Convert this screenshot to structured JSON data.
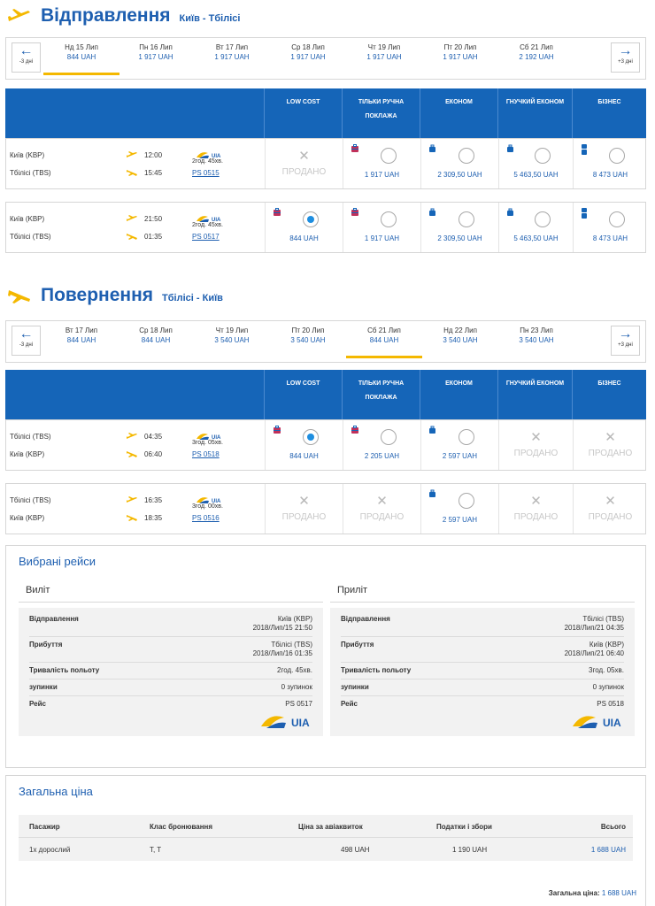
{
  "colors": {
    "brand_blue": "#1e5fb0",
    "header_blue": "#1565b8",
    "accent_yellow": "#f4b800",
    "radio_blue": "#1e8ee0",
    "sold_gray": "#c8c8c8"
  },
  "outbound": {
    "title": "Відправлення",
    "route": "Київ - Тбілісі",
    "prev_label": "-3 дні",
    "next_label": "+3 дні",
    "dates": [
      {
        "day": "Нд 15 Лип",
        "price": "844 UAH",
        "active": true
      },
      {
        "day": "Пн 16 Лип",
        "price": "1 917 UAH",
        "active": false
      },
      {
        "day": "Вт 17 Лип",
        "price": "1 917 UAH",
        "active": false
      },
      {
        "day": "Ср 18 Лип",
        "price": "1 917 UAH",
        "active": false
      },
      {
        "day": "Чт 19 Лип",
        "price": "1 917 UAH",
        "active": false
      },
      {
        "day": "Пт 20 Лип",
        "price": "1 917 UAH",
        "active": false
      },
      {
        "day": "Сб 21 Лип",
        "price": "2 192 UAH",
        "active": false
      }
    ],
    "fare_headers": [
      "LOW COST",
      "ТІЛЬКИ РУЧНА ПОКЛАЖА",
      "ЕКОНОМ",
      "ГНУЧКИЙ ЕКОНОМ",
      "БІЗНЕС"
    ],
    "flights": [
      {
        "dep_city": "Київ (KBP)",
        "arr_city": "Тбілісі (TBS)",
        "dep_time": "12:00",
        "arr_time": "15:45",
        "duration": "2год. 45хв.",
        "flight_no": "PS 0515",
        "airline_logo": "UIA",
        "fares": [
          {
            "status": "sold",
            "label": "ПРОДАНО",
            "bag": false
          },
          {
            "status": "open",
            "price": "1 917 UAH",
            "bag": "suitcase-red-icon"
          },
          {
            "status": "open",
            "price": "2 309,50 UAH",
            "bag": "bag-small-icon"
          },
          {
            "status": "open",
            "price": "5 463,50 UAH",
            "bag": "bag-small-icon"
          },
          {
            "status": "open",
            "price": "8 473 UAH",
            "bag": "bags-double-icon"
          }
        ]
      },
      {
        "dep_city": "Київ (KBP)",
        "arr_city": "Тбілісі (TBS)",
        "dep_time": "21:50",
        "arr_time": "01:35",
        "duration": "2год. 45хв.",
        "flight_no": "PS 0517",
        "airline_logo": "UIA",
        "fares": [
          {
            "status": "selected",
            "price": "844 UAH",
            "bag": "suitcase-red-icon"
          },
          {
            "status": "open",
            "price": "1 917 UAH",
            "bag": "suitcase-red-icon"
          },
          {
            "status": "open",
            "price": "2 309,50 UAH",
            "bag": "bag-small-icon"
          },
          {
            "status": "open",
            "price": "5 463,50 UAH",
            "bag": "bag-small-icon"
          },
          {
            "status": "open",
            "price": "8 473 UAH",
            "bag": "bags-double-icon"
          }
        ]
      }
    ]
  },
  "return": {
    "title": "Повернення",
    "route": "Тбілісі - Київ",
    "prev_label": "-3 дні",
    "next_label": "+3 дні",
    "dates": [
      {
        "day": "Вт 17 Лип",
        "price": "844 UAH",
        "active": false
      },
      {
        "day": "Ср 18 Лип",
        "price": "844 UAH",
        "active": false
      },
      {
        "day": "Чт 19 Лип",
        "price": "3 540 UAH",
        "active": false
      },
      {
        "day": "Пт 20 Лип",
        "price": "3 540 UAH",
        "active": false
      },
      {
        "day": "Сб 21 Лип",
        "price": "844 UAH",
        "active": true
      },
      {
        "day": "Нд 22 Лип",
        "price": "3 540 UAH",
        "active": false
      },
      {
        "day": "Пн 23 Лип",
        "price": "3 540 UAH",
        "active": false
      }
    ],
    "fare_headers": [
      "LOW COST",
      "ТІЛЬКИ РУЧНА ПОКЛАЖА",
      "ЕКОНОМ",
      "ГНУЧКИЙ ЕКОНОМ",
      "БІЗНЕС"
    ],
    "flights": [
      {
        "dep_city": "Тбілісі (TBS)",
        "arr_city": "Київ (KBP)",
        "dep_time": "04:35",
        "arr_time": "06:40",
        "duration": "3год. 05хв.",
        "flight_no": "PS 0518",
        "airline_logo": "UIA",
        "fares": [
          {
            "status": "selected",
            "price": "844 UAH",
            "bag": "suitcase-red-icon"
          },
          {
            "status": "open",
            "price": "2 205 UAH",
            "bag": "suitcase-red-icon"
          },
          {
            "status": "open",
            "price": "2 597 UAH",
            "bag": "bag-small-icon"
          },
          {
            "status": "sold",
            "label": "ПРОДАНО",
            "bag": false
          },
          {
            "status": "sold",
            "label": "ПРОДАНО",
            "bag": false
          }
        ]
      },
      {
        "dep_city": "Тбілісі (TBS)",
        "arr_city": "Київ (KBP)",
        "dep_time": "16:35",
        "arr_time": "18:35",
        "duration": "3год. 00хв.",
        "flight_no": "PS 0516",
        "airline_logo": "UIA",
        "fares": [
          {
            "status": "sold",
            "label": "ПРОДАНО",
            "bag": false
          },
          {
            "status": "sold",
            "label": "ПРОДАНО",
            "bag": false
          },
          {
            "status": "open",
            "price": "2 597 UAH",
            "bag": "bag-small-icon"
          },
          {
            "status": "sold",
            "label": "ПРОДАНО",
            "bag": false
          },
          {
            "status": "sold",
            "label": "ПРОДАНО",
            "bag": false
          }
        ]
      }
    ]
  },
  "selected": {
    "title": "Вибрані рейси",
    "legs": [
      {
        "title": "Виліт",
        "rows": [
          {
            "key": "Відправлення",
            "vals": [
              "Київ (KBP)",
              "2018/Лип/15 21:50"
            ]
          },
          {
            "key": "Прибуття",
            "vals": [
              "Тбілісі (TBS)",
              "2018/Лип/16 01:35"
            ]
          },
          {
            "key": "Тривалість польоту",
            "vals": [
              "2год. 45хв."
            ]
          },
          {
            "key": "зупинки",
            "vals": [
              "0 зупинок"
            ]
          },
          {
            "key": "Рейс",
            "vals": [
              "PS 0517"
            ],
            "logo": "UIA"
          }
        ]
      },
      {
        "title": "Приліт",
        "rows": [
          {
            "key": "Відправлення",
            "vals": [
              "Тбілісі (TBS)",
              "2018/Лип/21 04:35"
            ]
          },
          {
            "key": "Прибуття",
            "vals": [
              "Київ (KBP)",
              "2018/Лип/21 06:40"
            ]
          },
          {
            "key": "Тривалість польоту",
            "vals": [
              "3год. 05хв."
            ]
          },
          {
            "key": "зупинки",
            "vals": [
              "0 зупинок"
            ]
          },
          {
            "key": "Рейс",
            "vals": [
              "PS 0518"
            ],
            "logo": "UIA"
          }
        ]
      }
    ]
  },
  "total": {
    "title": "Загальна ціна",
    "headers": [
      "Пасажир",
      "Клас бронювання",
      "Ціна за авіаквиток",
      "Податки і збори",
      "Всього"
    ],
    "rows": [
      [
        "1x дорослий",
        "T, T",
        "498 UAH",
        "1 190 UAH",
        "1 688 UAH"
      ]
    ],
    "sum_label": "Загальна ціна:",
    "sum_value": "1 688 UAH"
  }
}
